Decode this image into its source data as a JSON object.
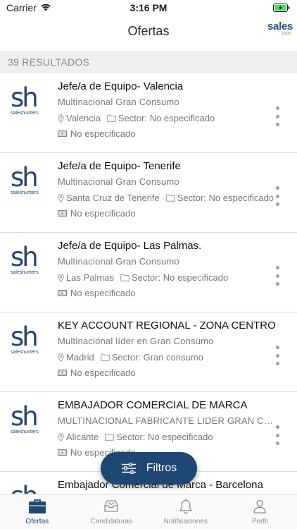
{
  "status_bar": {
    "carrier": "Carrier",
    "time": "3:16 PM"
  },
  "nav": {
    "title": "Ofertas",
    "logo_text": "sales",
    "logo_sub": "jobs"
  },
  "results": {
    "count_label": "39 RESULTADOS"
  },
  "company_logo": {
    "mark": "sh",
    "name": "saleshunters"
  },
  "offers": [
    {
      "title": "Jefe/a de Equipo- Valencia",
      "company": "Multinacional Gran Consumo",
      "location": "Valencia",
      "sector": "Sector: No especificado",
      "salary": "No especificado"
    },
    {
      "title": "Jefe/a de Equipo- Tenerife",
      "company": "Multinacional Gran Consumo",
      "location": "Santa Cruz de Tenerife",
      "sector": "Sector: No especificado",
      "salary": "No especificado"
    },
    {
      "title": "Jefe/a de Equipo- Las Palmas.",
      "company": "Multinacional Gran Consumo",
      "location": "Las Palmas",
      "sector": "Sector: No especificado",
      "salary": "No especificado"
    },
    {
      "title": "KEY ACCOUNT REGIONAL - ZONA CENTRO",
      "company": "Multinacional líder en Gran Consumo",
      "location": "Madrid",
      "sector": "Sector: Gran consumo",
      "salary": "No especificado"
    },
    {
      "title": "EMBAJADOR COMERCIAL DE MARCA",
      "company": "MULTINACIONAL FABRICANTE LIDER GRAN CONSUMO",
      "location": "Alicante",
      "sector": "Sector: No especificado",
      "salary": "No especificado"
    },
    {
      "title": "Embajador Comercial de Marca - Barcelona",
      "company": "",
      "location": "",
      "sector": "",
      "salary": ""
    }
  ],
  "filter_button": {
    "label": "Filtros"
  },
  "tabs": [
    {
      "label": "Ofertas",
      "icon": "briefcase-icon",
      "active": true
    },
    {
      "label": "Candidaturas",
      "icon": "inbox-icon",
      "active": false
    },
    {
      "label": "Notificaciones",
      "icon": "bell-icon",
      "active": false
    },
    {
      "label": "Perfil",
      "icon": "person-icon",
      "active": false
    }
  ],
  "colors": {
    "brand": "#1f4773",
    "accent_green": "#6aa841",
    "battery": "#4cd964"
  }
}
